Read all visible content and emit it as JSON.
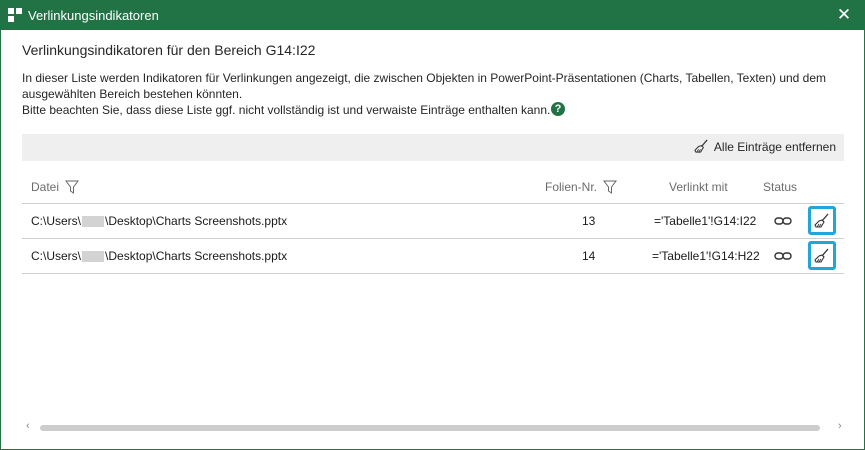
{
  "window": {
    "title": "Verlinkungsindikatoren",
    "close_glyph": "✕",
    "accent": "#217346"
  },
  "heading": "Verlinkungsindikatoren für den Bereich G14:I22",
  "description": {
    "line1": "In dieser Liste werden Indikatoren für Verlinkungen angezeigt, die zwischen Objekten in PowerPoint-Präsentationen (Charts, Tabellen, Texten) und dem",
    "line2": "ausgewählten Bereich bestehen könnten.",
    "line3": "Bitte beachten Sie, dass diese Liste ggf. nicht vollständig ist und verwaiste Einträge enthalten kann."
  },
  "help_icon": "question-icon",
  "toolbar": {
    "remove_all_label": "Alle Einträge entfernen",
    "remove_all_icon": "broom-icon"
  },
  "table": {
    "columns": {
      "file": "Datei",
      "slide_no": "Folien-Nr.",
      "linked_with": "Verlinkt mit",
      "status": "Status"
    },
    "rows": [
      {
        "path_prefix": "C:\\Users\\",
        "path_suffix": "\\Desktop\\Charts Screenshots.pptx",
        "slide": "13",
        "linked": "='Tabelle1'!G14:I22",
        "status_icon": "link-icon",
        "delete_icon": "broom-icon"
      },
      {
        "path_prefix": "C:\\Users\\",
        "path_suffix": "\\Desktop\\Charts Screenshots.pptx",
        "slide": "14",
        "linked": "='Tabelle1'!G14:H22",
        "status_icon": "link-icon",
        "delete_icon": "broom-icon"
      }
    ]
  },
  "scrollbar": {
    "left_arrow": "‹",
    "right_arrow": "›"
  },
  "highlight_color": "#1fa7d6"
}
